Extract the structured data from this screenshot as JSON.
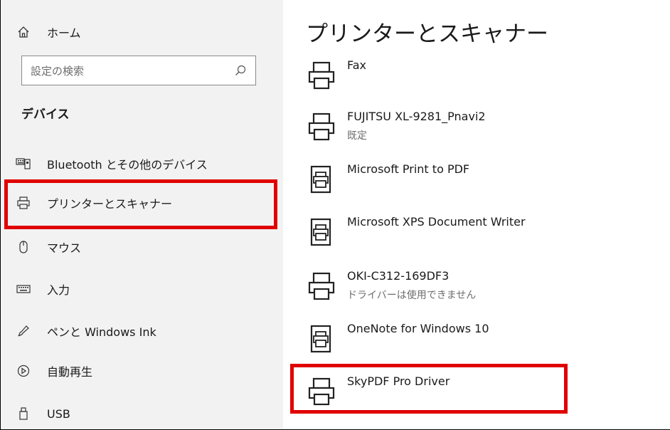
{
  "nav": {
    "home_label": "ホーム",
    "search_placeholder": "設定の検索",
    "section_title": "デバイス",
    "items": [
      {
        "label": "Bluetooth とその他のデバイス",
        "icon": "bluetooth-devices-icon"
      },
      {
        "label": "プリンターとスキャナー",
        "icon": "printer-icon",
        "selected": true
      },
      {
        "label": "マウス",
        "icon": "mouse-icon"
      },
      {
        "label": "入力",
        "icon": "keyboard-icon"
      },
      {
        "label": "ペンと Windows Ink",
        "icon": "pen-icon"
      },
      {
        "label": "自動再生",
        "icon": "autoplay-icon"
      },
      {
        "label": "USB",
        "icon": "usb-icon"
      }
    ]
  },
  "main": {
    "title": "プリンターとスキャナー",
    "devices": [
      {
        "name": "Fax",
        "status": "",
        "icon": "printer-icon"
      },
      {
        "name": "FUJITSU XL-9281_Pnavi2",
        "status": "既定",
        "icon": "printer-icon"
      },
      {
        "name": "Microsoft Print to PDF",
        "status": "",
        "icon": "document-printer-icon"
      },
      {
        "name": "Microsoft XPS Document Writer",
        "status": "",
        "icon": "document-printer-icon"
      },
      {
        "name": "OKI-C312-169DF3",
        "status": "ドライバーは使用できません",
        "icon": "printer-icon"
      },
      {
        "name": "OneNote for Windows 10",
        "status": "",
        "icon": "document-printer-icon"
      },
      {
        "name": "SkyPDF Pro Driver",
        "status": "",
        "icon": "printer-icon"
      }
    ]
  },
  "colors": {
    "highlight": "#e00000",
    "accent": "#0063b1",
    "nav_bg": "#f2f2f2"
  }
}
